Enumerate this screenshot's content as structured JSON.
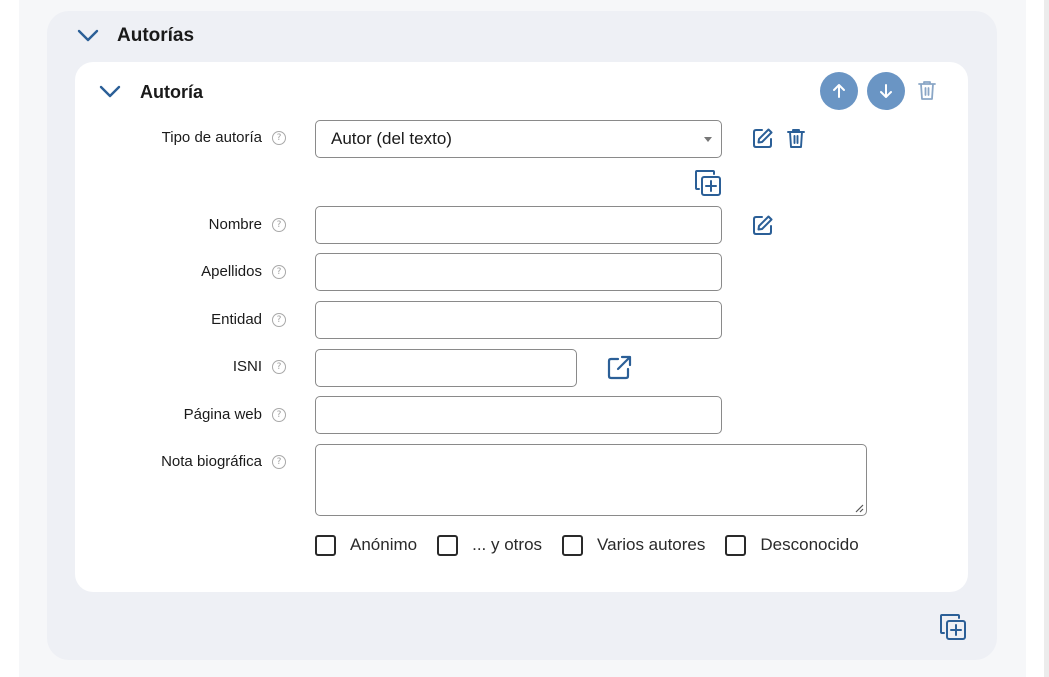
{
  "section": {
    "title": "Autorías"
  },
  "authorship": {
    "title": "Autoría",
    "fields": {
      "tipo": {
        "label": "Tipo de autoría",
        "value": "Autor (del texto)"
      },
      "nombre": {
        "label": "Nombre",
        "value": ""
      },
      "apellidos": {
        "label": "Apellidos",
        "value": ""
      },
      "entidad": {
        "label": "Entidad",
        "value": ""
      },
      "isni": {
        "label": "ISNI",
        "value": ""
      },
      "web": {
        "label": "Página web",
        "value": ""
      },
      "nota": {
        "label": "Nota biográfica",
        "value": ""
      }
    },
    "help_glyph": "?",
    "checkboxes": [
      {
        "label": "Anónimo",
        "checked": false
      },
      {
        "label": "... y otros",
        "checked": false
      },
      {
        "label": "Varios autores",
        "checked": false
      },
      {
        "label": "Desconocido",
        "checked": false
      }
    ]
  },
  "icons": {
    "collapse": "chevron-down-icon",
    "move_up": "arrow-up-icon",
    "move_down": "arrow-down-icon",
    "delete": "trash-icon",
    "edit": "edit-icon",
    "add": "add-copy-icon",
    "external": "external-link-icon"
  },
  "colors": {
    "accent": "#2b5f97",
    "circle_button": "#6a95c4",
    "trash_muted": "#8aa6c6",
    "outer_card": "#eef0f5"
  }
}
